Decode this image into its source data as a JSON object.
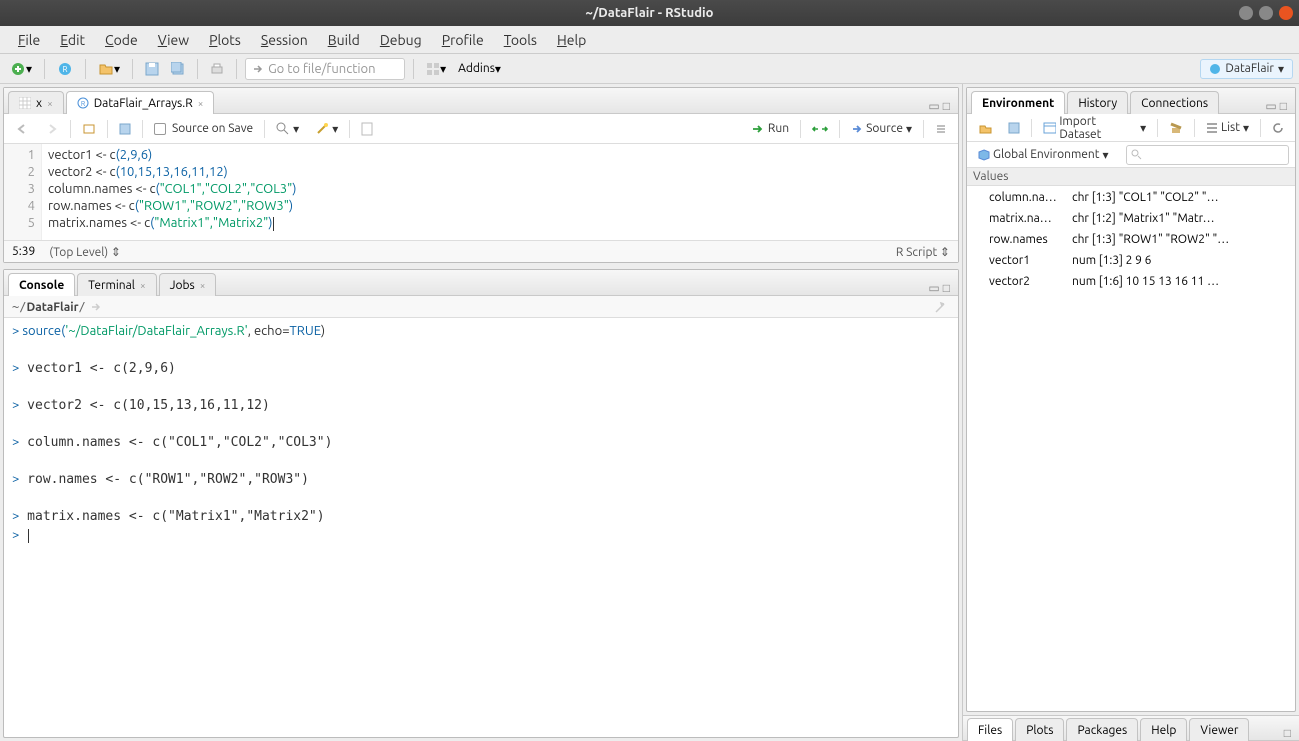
{
  "window": {
    "title": "~/DataFlair - RStudio"
  },
  "menubar": [
    "File",
    "Edit",
    "Code",
    "View",
    "Plots",
    "Session",
    "Build",
    "Debug",
    "Profile",
    "Tools",
    "Help"
  ],
  "toolbar": {
    "goto_placeholder": "Go to file/function",
    "addins_label": "Addins",
    "project_name": "DataFlair"
  },
  "source_pane": {
    "tabs": [
      {
        "label": "x",
        "kind": "data"
      },
      {
        "label": "DataFlair_Arrays.R",
        "kind": "r"
      }
    ],
    "source_on_save": "Source on Save",
    "run_label": "Run",
    "source_label": "Source",
    "lines": [
      {
        "n": 1,
        "raw": "vector1 <- c(",
        "nums": "2,9,6",
        "tail": ")"
      },
      {
        "n": 2,
        "raw": "vector2 <- c(",
        "nums": "10,15,13,16,11,12",
        "tail": ")"
      },
      {
        "n": 3,
        "raw": "column.names <- c(",
        "str": "\"COL1\",\"COL2\",\"COL3\"",
        "tail": ")"
      },
      {
        "n": 4,
        "raw": "row.names <- c(",
        "str": "\"ROW1\",\"ROW2\",\"ROW3\"",
        "tail": ")"
      },
      {
        "n": 5,
        "raw": "matrix.names <- c(",
        "str": "\"Matrix1\",\"Matrix2\"",
        "tail": ")"
      }
    ],
    "status_pos": "5:39",
    "status_scope": "(Top Level)",
    "status_type": "R Script"
  },
  "console": {
    "tabs": [
      "Console",
      "Terminal",
      "Jobs"
    ],
    "path": "~/DataFlair/",
    "lines": [
      {
        "prompt": ">",
        "pre": " source(",
        "func_blue": true,
        "str": "'~/DataFlair/DataFlair_Arrays.R'",
        "mid": ", echo=",
        "kw": "TRUE",
        "tail": ")"
      },
      {
        "blank": true
      },
      {
        "prompt": ">",
        "plain": " vector1 <- c(2,9,6)"
      },
      {
        "blank": true
      },
      {
        "prompt": ">",
        "plain": " vector2 <- c(10,15,13,16,11,12)"
      },
      {
        "blank": true
      },
      {
        "prompt": ">",
        "plain": " column.names <- c(\"COL1\",\"COL2\",\"COL3\")"
      },
      {
        "blank": true
      },
      {
        "prompt": ">",
        "plain": " row.names <- c(\"ROW1\",\"ROW2\",\"ROW3\")"
      },
      {
        "blank": true
      },
      {
        "prompt": ">",
        "plain": " matrix.names <- c(\"Matrix1\",\"Matrix2\")"
      },
      {
        "prompt": ">",
        "plain": " ",
        "cursor": true
      }
    ]
  },
  "env_pane": {
    "tabs": [
      "Environment",
      "History",
      "Connections"
    ],
    "import_label": "Import Dataset",
    "list_label": "List",
    "scope_label": "Global Environment",
    "section": "Values",
    "rows": [
      {
        "name": "column.na…",
        "value": "chr [1:3] \"COL1\" \"COL2\" \"…"
      },
      {
        "name": "matrix.na…",
        "value": "chr [1:2] \"Matrix1\" \"Matr…"
      },
      {
        "name": "row.names",
        "value": "chr [1:3] \"ROW1\" \"ROW2\" \"…"
      },
      {
        "name": "vector1",
        "value": "num [1:3] 2 9 6"
      },
      {
        "name": "vector2",
        "value": "num [1:6] 10 15 13 16 11 …"
      }
    ]
  },
  "lower_right": {
    "tabs": [
      "Files",
      "Plots",
      "Packages",
      "Help",
      "Viewer"
    ]
  }
}
